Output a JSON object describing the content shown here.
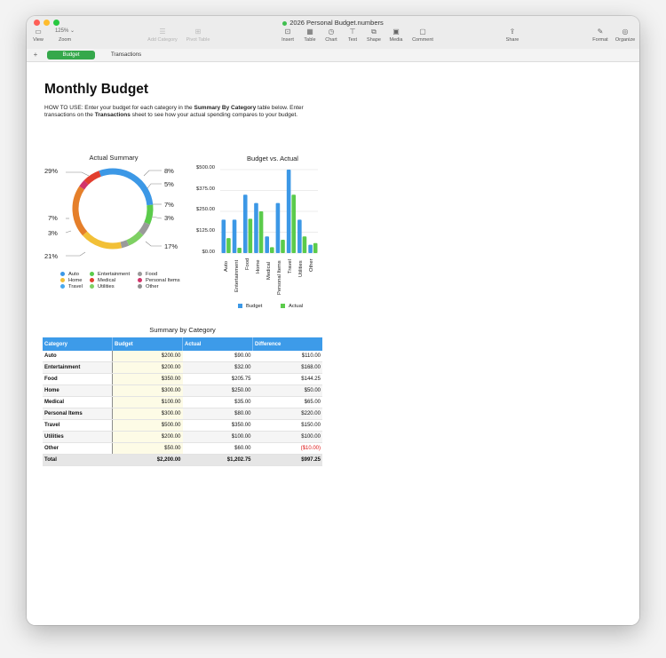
{
  "window": {
    "title": "2026 Personal Budget.numbers"
  },
  "toolbar": {
    "view": "View",
    "zoom_value": "125% ⌄",
    "zoom": "Zoom",
    "add_category": "Add Category",
    "pivot_table": "Pivot Table",
    "insert": "Insert",
    "table": "Table",
    "chart": "Chart",
    "text": "Text",
    "shape": "Shape",
    "media": "Media",
    "comment": "Comment",
    "share": "Share",
    "format": "Format",
    "organize": "Organize"
  },
  "tabs": {
    "add": "+",
    "items": [
      {
        "label": "Budget"
      },
      {
        "label": "Transactions"
      }
    ]
  },
  "page": {
    "title": "Monthly Budget",
    "howto": {
      "p1": "HOW TO USE: Enter your budget for each category in the ",
      "b1": "Summary By Category",
      "p2": " table below. Enter transactions on the ",
      "b2": "Transactions",
      "p3": " sheet to see how your actual spending compares to your budget."
    }
  },
  "donut": {
    "title": "Actual Summary",
    "labels": {
      "auto": "8%",
      "entertainment": "5%",
      "food": "7%",
      "home": "3%",
      "medical": "17%",
      "personal": "21%",
      "travel": "3%",
      "utilities": "7%",
      "other": "29%"
    },
    "legend": [
      {
        "label": "Auto",
        "color": "#3c98e6"
      },
      {
        "label": "Entertainment",
        "color": "#5bcb4b"
      },
      {
        "label": "Food",
        "color": "#9a9a9a"
      },
      {
        "label": "Home",
        "color": "#f2c037"
      },
      {
        "label": "Medical",
        "color": "#e23e2f"
      },
      {
        "label": "Personal Items",
        "color": "#d2346b"
      },
      {
        "label": "Travel",
        "color": "#49a9ee"
      },
      {
        "label": "Utilities",
        "color": "#7ed063"
      },
      {
        "label": "Other",
        "color": "#8f8f8f"
      }
    ]
  },
  "chart_data": [
    {
      "type": "pie",
      "title": "Actual Summary",
      "categories": [
        "Other",
        "Auto",
        "Entertainment",
        "Food",
        "Home",
        "Medical",
        "Personal Items",
        "Travel",
        "Utilities"
      ],
      "values": [
        29,
        8,
        5,
        7,
        3,
        17,
        21,
        3,
        7
      ],
      "colors": [
        "#3c98e6",
        "#5bcb4b",
        "#9a9a9a",
        "#7ed063",
        "#9a9a9a",
        "#f2c037",
        "#e57f2a",
        "#d2346b",
        "#e23e2f"
      ]
    },
    {
      "type": "bar",
      "title": "Budget vs. Actual",
      "categories": [
        "Auto",
        "Entertainment",
        "Food",
        "Home",
        "Medical",
        "Personal Items",
        "Travel",
        "Utilities",
        "Other"
      ],
      "series": [
        {
          "name": "Budget",
          "values": [
            200,
            200,
            350,
            300,
            100,
            300,
            500,
            200,
            50
          ],
          "color": "#3c98e6"
        },
        {
          "name": "Actual",
          "values": [
            90,
            32,
            205.75,
            250,
            35,
            80,
            350,
            100,
            60
          ],
          "color": "#5bcb4b"
        }
      ],
      "ylim": [
        0,
        500
      ],
      "yticks": [
        "$0.00",
        "$125.00",
        "$250.00",
        "$375.00",
        "$500.00"
      ],
      "legend": "bottom"
    }
  ],
  "summary": {
    "title": "Summary by Category",
    "headers": [
      "Category",
      "Budget",
      "Actual",
      "Difference"
    ],
    "rows": [
      [
        "Auto",
        "$200.00",
        "$90.00",
        "$110.00"
      ],
      [
        "Entertainment",
        "$200.00",
        "$32.00",
        "$168.00"
      ],
      [
        "Food",
        "$350.00",
        "$205.75",
        "$144.25"
      ],
      [
        "Home",
        "$300.00",
        "$250.00",
        "$50.00"
      ],
      [
        "Medical",
        "$100.00",
        "$35.00",
        "$65.00"
      ],
      [
        "Personal Items",
        "$300.00",
        "$80.00",
        "$220.00"
      ],
      [
        "Travel",
        "$500.00",
        "$350.00",
        "$150.00"
      ],
      [
        "Utilities",
        "$200.00",
        "$100.00",
        "$100.00"
      ],
      [
        "Other",
        "$50.00",
        "$60.00",
        "($10.00)"
      ]
    ],
    "total": [
      "Total",
      "$2,200.00",
      "$1,202.75",
      "$997.25"
    ]
  }
}
